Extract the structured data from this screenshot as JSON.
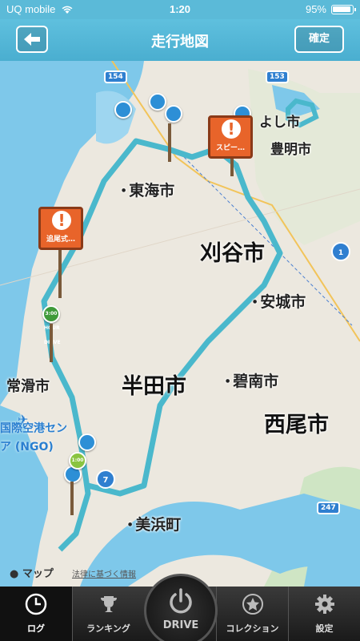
{
  "status_bar": {
    "carrier": "UQ mobile",
    "time": "1:20",
    "battery": "95%"
  },
  "nav": {
    "title": "走行地図",
    "confirm_label": "確定",
    "back_icon": "arrow-left-icon"
  },
  "map": {
    "cities": {
      "tokai": "東海市",
      "kariya": "刈谷市",
      "anjo": "安城市",
      "handa": "半田市",
      "hekinan": "碧南市",
      "nishio": "西尾市",
      "tokoname": "常滑市",
      "mihama": "美浜町",
      "toyoake": "豊明市",
      "obu_fragment": "よし市"
    },
    "airport_lines": [
      "国際空港セン",
      "ア (NGO)"
    ],
    "route_numbers": [
      "154",
      "153",
      "1",
      "7",
      "247"
    ],
    "signs": [
      {
        "label": "追尾式…"
      },
      {
        "label": "スピー…"
      }
    ],
    "pins": [
      {
        "label": "3:00 HOUR DRIVE",
        "color": "#3f9a3a"
      },
      {
        "label": "1:00",
        "color": "#8ac440"
      }
    ],
    "apple_maps_label": "マップ",
    "legal_label": "法律に基づく情報"
  },
  "tab_bar": {
    "tabs": [
      {
        "label": "ログ",
        "icon": "clock-icon"
      },
      {
        "label": "ランキング",
        "icon": "trophy-icon"
      },
      {
        "label": "DRIVE",
        "icon": "power-icon"
      },
      {
        "label": "コレクション",
        "icon": "star-badge-icon"
      },
      {
        "label": "設定",
        "icon": "gear-icon"
      }
    ]
  },
  "colors": {
    "header": "#5bbad8",
    "route": "#4ab8cc",
    "water": "#7ec8ea",
    "sign": "#e8642a"
  }
}
